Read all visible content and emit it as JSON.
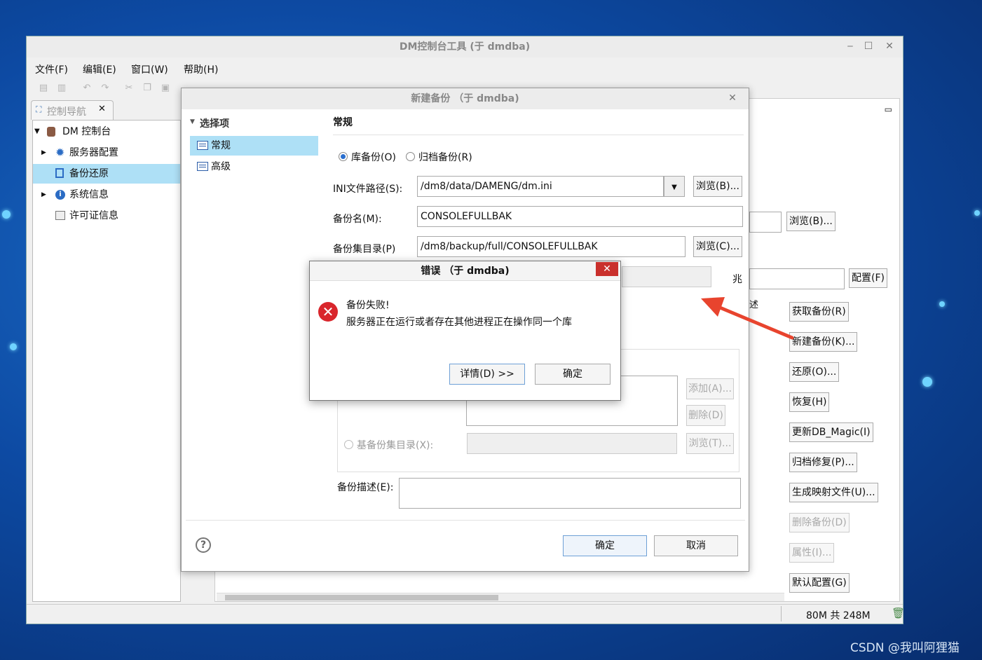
{
  "main_window": {
    "title": "DM控制台工具 (于 dmdba)",
    "menu": [
      "文件(F)",
      "编辑(E)",
      "窗口(W)",
      "帮助(H)"
    ],
    "nav_tab_label": "控制导航",
    "tree": {
      "root": "DM 控制台",
      "items": [
        "服务器配置",
        "备份还原",
        "系统信息",
        "许可证信息"
      ]
    },
    "status": "80M 共 248M"
  },
  "right_panel": {
    "browse_b": "浏览(B)...",
    "config_f": "配置(F)",
    "buttons": [
      {
        "label": "获取备份(R)",
        "enabled": true
      },
      {
        "label": "新建备份(K)...",
        "enabled": true
      },
      {
        "label": "还原(O)...",
        "enabled": true
      },
      {
        "label": "恢复(H)",
        "enabled": true
      },
      {
        "label": "更新DB_Magic(I)",
        "enabled": true
      },
      {
        "label": "归档修复(P)...",
        "enabled": true
      },
      {
        "label": "生成映射文件(U)...",
        "enabled": true
      },
      {
        "label": "删除备份(D)",
        "enabled": false
      },
      {
        "label": "属性(I)...",
        "enabled": false
      },
      {
        "label": "默认配置(G)",
        "enabled": true
      }
    ]
  },
  "backup_dialog": {
    "title": "新建备份 （于 dmdba)",
    "options_header": "选择项",
    "options": [
      "常规",
      "高级"
    ],
    "section": "常规",
    "radio_db": "库备份(O)",
    "radio_archive": "归档备份(R)",
    "ini_label": "INI文件路径(S):",
    "ini_value": "/dm8/data/DAMENG/dm.ini",
    "ini_browse": "浏览(B)...",
    "name_label": "备份名(M):",
    "name_value": "CONSOLEFULLBAK",
    "dir_label": "备份集目录(P)",
    "dir_value": "/dm8/backup/full/CONSOLEFULLBAK",
    "dir_browse": "浏览(C)...",
    "size_unit": "兆",
    "add_btn": "添加(A)...",
    "del_btn": "删除(D)",
    "base_label": "基备份集目录(X):",
    "base_browse": "浏览(T)...",
    "desc_label": "备份描述(E):",
    "ok": "确定",
    "cancel": "取消"
  },
  "error_dialog": {
    "title": "错误 （于 dmdba)",
    "message_line1": "备份失败!",
    "message_line2": "服务器正在运行或者存在其他进程正在操作同一个库",
    "details": "详情(D) >>",
    "ok": "确定"
  },
  "watermark": "CSDN @我叫阿狸猫",
  "colors": {
    "selection": "#aee0f6",
    "error_red": "#d9262c",
    "arrow_red": "#e8442e"
  }
}
